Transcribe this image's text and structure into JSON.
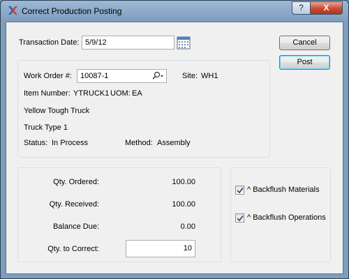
{
  "window": {
    "title": "Correct Production Posting",
    "help_label": "?",
    "close_label": "X",
    "icon": "x-app-icon"
  },
  "transaction": {
    "date_label": "Transaction Date:",
    "date_value": "5/9/12"
  },
  "buttons": {
    "cancel": "Cancel",
    "post": "Post"
  },
  "work_order": {
    "label": "Work Order #:",
    "value": "10087-1",
    "site_label": "Site:",
    "site_value": "WH1",
    "item_label": "Item Number:",
    "item_value": "YTRUCK1",
    "uom_label": "UOM:",
    "uom_value": "EA",
    "description1": "Yellow Tough Truck",
    "description2": "Truck Type 1",
    "status_label": "Status:",
    "status_value": "In Process",
    "method_label": "Method:",
    "method_value": "Assembly"
  },
  "quantities": {
    "ordered_label": "Qty. Ordered:",
    "ordered_value": "100.00",
    "received_label": "Qty. Received:",
    "received_value": "100.00",
    "balance_label": "Balance Due:",
    "balance_value": "0.00",
    "correct_label": "Qty. to Correct:",
    "correct_value": "10"
  },
  "options": {
    "backflush_materials_label": "^ Backflush Materials",
    "backflush_materials_checked": true,
    "backflush_operations_label": "^ Backflush Operations",
    "backflush_operations_checked": true
  }
}
